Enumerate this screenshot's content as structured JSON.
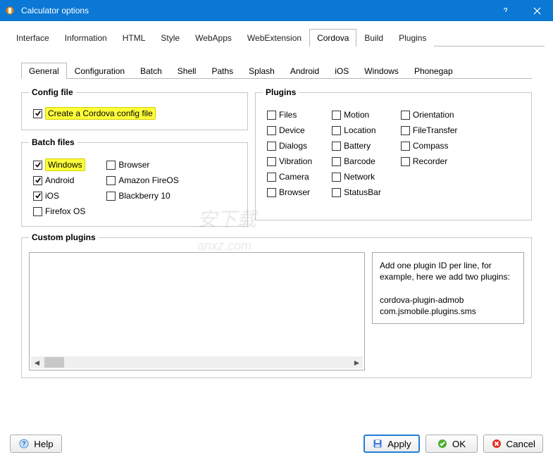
{
  "window": {
    "title": "Calculator options"
  },
  "tabs": {
    "outer": [
      "Interface",
      "Information",
      "HTML",
      "Style",
      "WebApps",
      "WebExtension",
      "Cordova",
      "Build",
      "Plugins"
    ],
    "outer_active": 6,
    "inner": [
      "General",
      "Configuration",
      "Batch",
      "Shell",
      "Paths",
      "Splash",
      "Android",
      "iOS",
      "Windows",
      "Phonegap"
    ],
    "inner_active": 0
  },
  "groups": {
    "config_title": "Config file",
    "config_check_label": "Create a Cordova config file",
    "config_check_value": true,
    "config_check_highlight": true,
    "batch_title": "Batch files",
    "batch_left": [
      {
        "label": "Windows",
        "checked": true,
        "highlight": true
      },
      {
        "label": "Android",
        "checked": true,
        "highlight": false
      },
      {
        "label": "iOS",
        "checked": true,
        "highlight": false
      },
      {
        "label": "Firefox OS",
        "checked": false,
        "highlight": false
      }
    ],
    "batch_right": [
      {
        "label": "Browser",
        "checked": false
      },
      {
        "label": "Amazon FireOS",
        "checked": false
      },
      {
        "label": "Blackberry 10",
        "checked": false
      }
    ],
    "plugins_title": "Plugins",
    "plugins_cols": [
      [
        "Files",
        "Device",
        "Dialogs",
        "Vibration",
        "Camera",
        "Browser"
      ],
      [
        "Motion",
        "Location",
        "Battery",
        "Barcode",
        "Network",
        "StatusBar"
      ],
      [
        "Orientation",
        "FileTransfer",
        "Compass",
        "Recorder"
      ]
    ],
    "custom_title": "Custom plugins",
    "custom_help": "Add one plugin ID per line, for example, here we add two plugins:\n\ncordova-plugin-admob\ncom.jsmobile.plugins.sms"
  },
  "footer": {
    "help": "Help",
    "apply": "Apply",
    "ok": "OK",
    "cancel": "Cancel"
  }
}
